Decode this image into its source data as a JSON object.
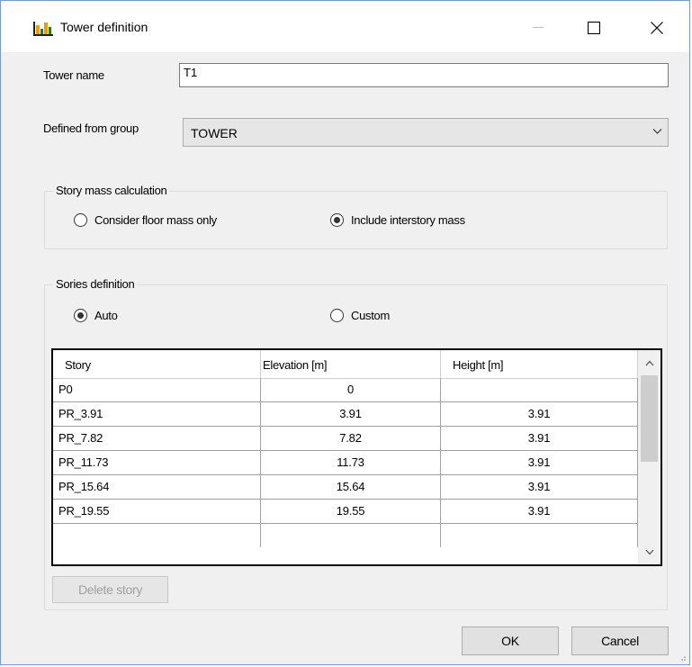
{
  "window": {
    "title": "Tower definition",
    "icon": "tower-chart-icon",
    "minimize_icon": "minimize-icon",
    "maximize_icon": "maximize-icon",
    "close_icon": "close-icon"
  },
  "tower_name": {
    "label": "Tower name",
    "value": "T1"
  },
  "group": {
    "label": "Defined from group",
    "selected": "TOWER"
  },
  "mass_calc": {
    "legend": "Story mass calculation",
    "options": [
      {
        "label": "Consider floor mass only",
        "checked": false
      },
      {
        "label": "Include interstory mass",
        "checked": true
      }
    ]
  },
  "stories": {
    "legend": "Sories definition",
    "options": [
      {
        "label": "Auto",
        "checked": true
      },
      {
        "label": "Custom",
        "checked": false
      }
    ],
    "columns": [
      "Story",
      "Elevation [m]",
      "Height [m]"
    ],
    "rows": [
      {
        "story": "P0",
        "elevation": "0",
        "height": ""
      },
      {
        "story": "PR_3.91",
        "elevation": "3.91",
        "height": "3.91"
      },
      {
        "story": "PR_7.82",
        "elevation": "7.82",
        "height": "3.91"
      },
      {
        "story": "PR_11.73",
        "elevation": "11.73",
        "height": "3.91"
      },
      {
        "story": "PR_15.64",
        "elevation": "15.64",
        "height": "3.91"
      },
      {
        "story": "PR_19.55",
        "elevation": "19.55",
        "height": "3.91"
      }
    ],
    "delete_label": "Delete story"
  },
  "buttons": {
    "ok": "OK",
    "cancel": "Cancel"
  }
}
